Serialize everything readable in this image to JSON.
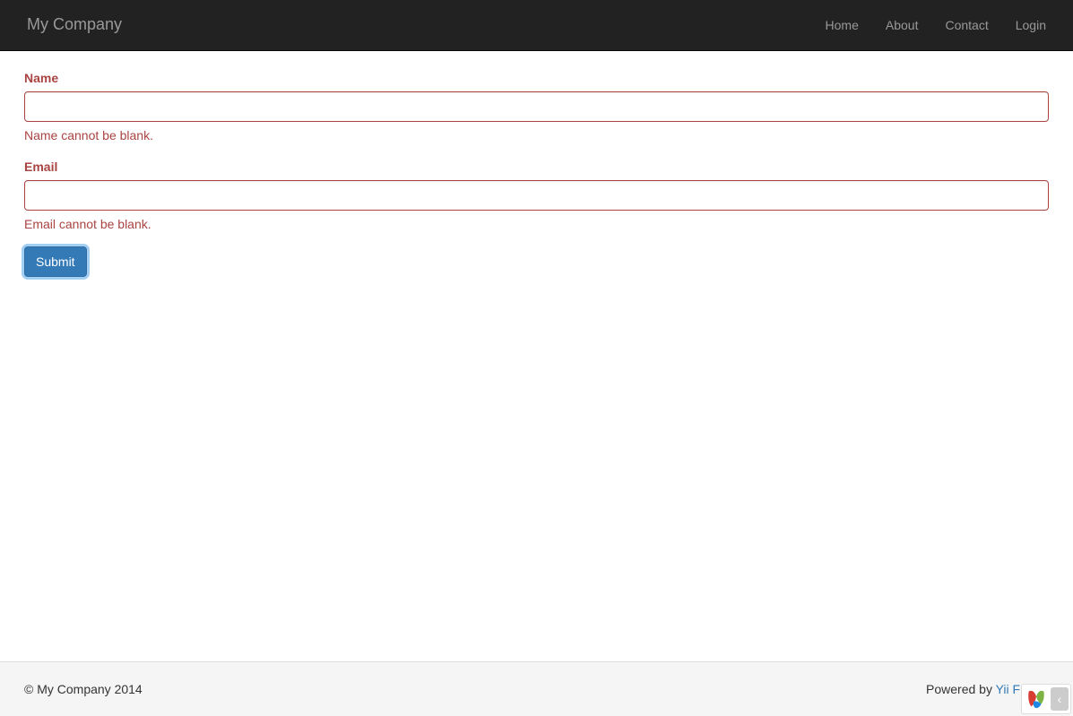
{
  "navbar": {
    "brand": "My Company",
    "links": {
      "home": "Home",
      "about": "About",
      "contact": "Contact",
      "login": "Login"
    }
  },
  "form": {
    "name": {
      "label": "Name",
      "value": "",
      "error": "Name cannot be blank."
    },
    "email": {
      "label": "Email",
      "value": "",
      "error": "Email cannot be blank."
    },
    "submit_label": "Submit"
  },
  "footer": {
    "copyright": "© My Company 2014",
    "powered_by_prefix": "Powered by ",
    "powered_by_link": "Yii Frame"
  },
  "debug": {
    "toggle_glyph": "‹"
  }
}
